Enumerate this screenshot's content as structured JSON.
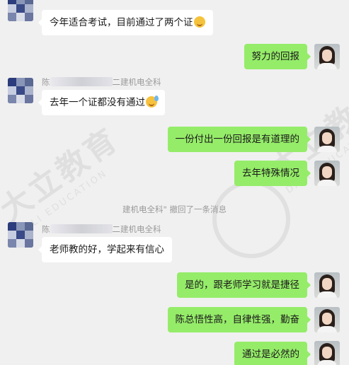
{
  "chat": {
    "messages": [
      {
        "side": "in",
        "text": "今年适合考试，目前通过了两个证",
        "emoji": "thinking-emoji"
      },
      {
        "side": "out",
        "text": "努力的回报"
      },
      {
        "side": "in",
        "sender_prefix": "陈",
        "sender_suffix": "二建机电全科",
        "text": "去年一个证都没有通过",
        "emoji": "sweat-emoji"
      },
      {
        "side": "out",
        "text": "一份付出一份回报是有道理的"
      },
      {
        "side": "out",
        "text": "去年特殊情况"
      },
      {
        "side": "in",
        "sender_prefix": "陈",
        "sender_suffix": "二建机电全科",
        "text": "老师教的好，学起来有信心"
      },
      {
        "side": "out",
        "text": "是的，跟老师学习就是捷径"
      },
      {
        "side": "out",
        "text": "陈总悟性高，自律性强，勤奋"
      },
      {
        "side": "out",
        "text": "通过是必然的"
      }
    ],
    "system_notice": "建机电全科\" 撤回了一条消息"
  },
  "watermark": {
    "brand": "大立教育",
    "sub": "DALI EDUCATION"
  }
}
